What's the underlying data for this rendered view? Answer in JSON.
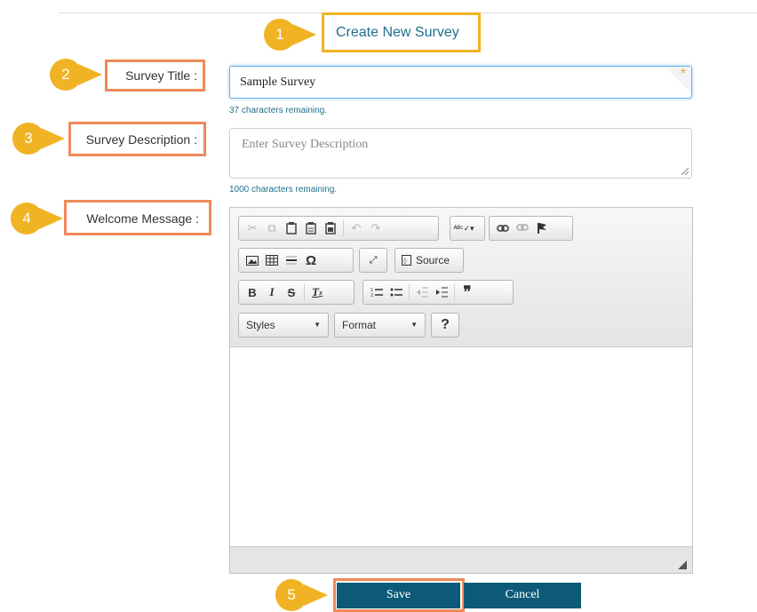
{
  "header": {
    "title": "Create New Survey"
  },
  "callouts": [
    "1",
    "2",
    "3",
    "4",
    "5"
  ],
  "form": {
    "survey_title_label": "Survey Title :",
    "survey_title_value": "Sample Survey",
    "survey_title_hint": "37 characters remaining.",
    "required_mark": "*",
    "survey_description_label": "Survey Description :",
    "survey_description_placeholder": "Enter Survey Description",
    "survey_description_hint": "1000 characters remaining.",
    "welcome_message_label": "Welcome Message :"
  },
  "editor": {
    "source_label": "Source",
    "styles_label": "Styles",
    "format_label": "Format",
    "help_label": "?",
    "icons": [
      "cut-icon",
      "copy-icon",
      "paste-icon",
      "paste-text-icon",
      "paste-word-icon",
      "undo-icon",
      "redo-icon",
      "spellcheck-icon",
      "link-icon",
      "unlink-icon",
      "anchor-icon",
      "image-icon",
      "table-icon",
      "horizontal-line-icon",
      "special-char-icon",
      "maximize-icon",
      "source-icon",
      "bold-icon",
      "italic-icon",
      "strike-icon",
      "remove-format-icon",
      "numbered-list-icon",
      "bulleted-list-icon",
      "outdent-icon",
      "indent-icon",
      "blockquote-icon"
    ]
  },
  "actions": {
    "save_label": "Save",
    "cancel_label": "Cancel"
  },
  "colors": {
    "accent": "#1f6f8b",
    "button": "#0d5a78",
    "callout": "#f0b323",
    "highlight": "#ef8a5a"
  }
}
